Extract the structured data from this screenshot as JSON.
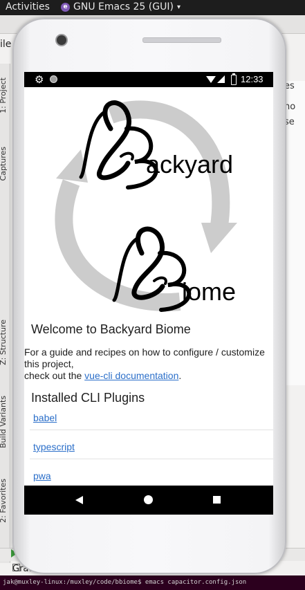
{
  "desktop": {
    "activities_label": "Activities",
    "app_name": "GNU Emacs 25 (GUI)",
    "caret": "▾"
  },
  "ide": {
    "file_menu": "ile",
    "left_tool_tabs": [
      "1: Project",
      "Captures",
      "Z: Structure",
      "Build Variants",
      "2: Favorites"
    ],
    "right_panel_fragments": [
      "es",
      "no",
      "se"
    ],
    "gradle_label": "Gradl"
  },
  "terminal": {
    "prompt_line": "jak@muxley-linux:/muxley/code/bbiome$ emacs capacitor.config.json"
  },
  "status_bar": {
    "time": "12:33",
    "icons": [
      "gear-icon",
      "circle-notification-icon",
      "wifi-icon",
      "signal-icon",
      "battery-icon"
    ]
  },
  "page": {
    "logo_text": {
      "top_word": "ackyard",
      "bottom_word": "iome"
    },
    "welcome_heading": "Welcome to Backyard Biome",
    "intro_text": "For a guide and recipes on how to configure / customize this project,",
    "check_out_prefix": "check out the",
    "docs_link": "vue-cli documentation",
    "docs_suffix": ".",
    "plugins_heading": "Installed CLI Plugins",
    "plugins": [
      "babel",
      "typescript",
      "pwa"
    ]
  },
  "nav_bar": {
    "buttons": [
      "back-icon",
      "home-icon",
      "recents-icon"
    ]
  },
  "colors": {
    "link": "#2a6ec9",
    "status_bar": "#000000",
    "arrow_gray": "#cccccc",
    "terminal_bg": "#2c001e"
  }
}
